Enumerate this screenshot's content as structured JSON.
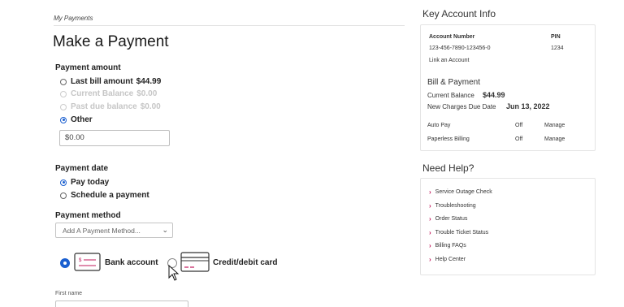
{
  "breadcrumb": "My Payments",
  "page_title": "Make a Payment",
  "payment_amount": {
    "label": "Payment amount",
    "options": [
      {
        "label": "Last bill amount",
        "amount": "$44.99",
        "checked": false,
        "disabled": false
      },
      {
        "label": "Current Balance",
        "amount": "$0.00",
        "checked": false,
        "disabled": true
      },
      {
        "label": "Past due balance",
        "amount": "$0.00",
        "checked": false,
        "disabled": true
      },
      {
        "label": "Other",
        "amount": "",
        "checked": true,
        "disabled": false
      }
    ],
    "other_value": "$0.00"
  },
  "payment_date": {
    "label": "Payment date",
    "options": [
      {
        "label": "Pay today",
        "checked": true
      },
      {
        "label": "Schedule a payment",
        "checked": false
      }
    ]
  },
  "payment_method": {
    "label": "Payment method",
    "select_value": "Add A Payment Method...",
    "choices": [
      {
        "label": "Bank account",
        "checked": true,
        "icon": "bank-check-icon"
      },
      {
        "label": "Credit/debit card",
        "checked": false,
        "icon": "credit-card-icon"
      }
    ]
  },
  "first_name_label": "First name",
  "key_account": {
    "heading": "Key Account Info",
    "account_number_label": "Account Number",
    "account_number": "123-456-7890-123456-0",
    "pin_label": "PIN",
    "pin": "1234",
    "link_account": "Link an Account",
    "bill_heading": "Bill & Payment",
    "current_balance_label": "Current Balance",
    "current_balance": "$44.99",
    "due_date_label": "New Charges Due Date",
    "due_date": "Jun 13, 2022",
    "rows": [
      {
        "label": "Auto Pay",
        "status": "Off",
        "action": "Manage"
      },
      {
        "label": "Paperless Billing",
        "status": "Off",
        "action": "Manage"
      }
    ]
  },
  "help": {
    "heading": "Need Help?",
    "items": [
      "Service Outage Check",
      "Troubleshooting",
      "Order Status",
      "Trouble Ticket Status",
      "Billing FAQs",
      "Help Center"
    ]
  },
  "colors": {
    "accent": "#1a5fd0",
    "link_arrow": "#c2185b"
  }
}
